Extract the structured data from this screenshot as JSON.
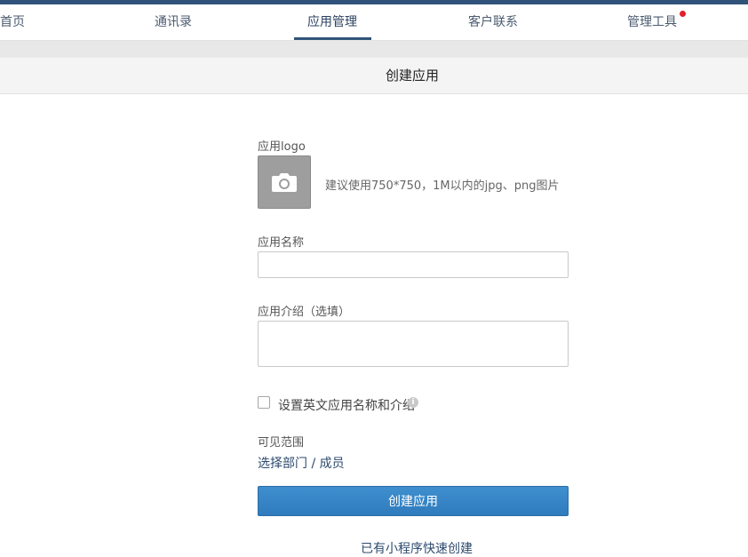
{
  "nav": {
    "items": [
      {
        "label": "首页"
      },
      {
        "label": "通讯录"
      },
      {
        "label": "应用管理"
      },
      {
        "label": "客户联系"
      },
      {
        "label": "管理工具"
      }
    ],
    "active": "应用管理"
  },
  "page": {
    "title": "创建应用"
  },
  "form": {
    "logo_label": "应用logo",
    "logo_hint": "建议使用750*750，1M以内的jpg、png图片",
    "name_label": "应用名称",
    "name_value": "",
    "intro_label": "应用介绍（选填）",
    "intro_value": "",
    "english_checkbox_label": "设置英文应用名称和介绍",
    "english_checkbox_checked": false,
    "visibility_label": "可见范围",
    "visibility_link": "选择部门 / 成员",
    "submit_label": "创建应用",
    "quick_create_link": "已有小程序快速创建"
  },
  "colors": {
    "top_stripe": "#31537a",
    "primary_button": "#2f7bbd",
    "notification_dot": "#e0212b"
  }
}
